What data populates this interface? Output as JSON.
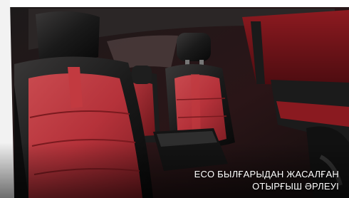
{
  "caption": {
    "line1": "ECO БЫЛҒАРЫДАН ЖАСАЛҒАН",
    "line2": "ОТЫРҒЫШ ӘРЛЕУІ"
  },
  "colors": {
    "accent_red": "#b5323a",
    "leather_black": "#141414",
    "trim_red": "#7d1419",
    "caption_text": "#ffffff"
  }
}
